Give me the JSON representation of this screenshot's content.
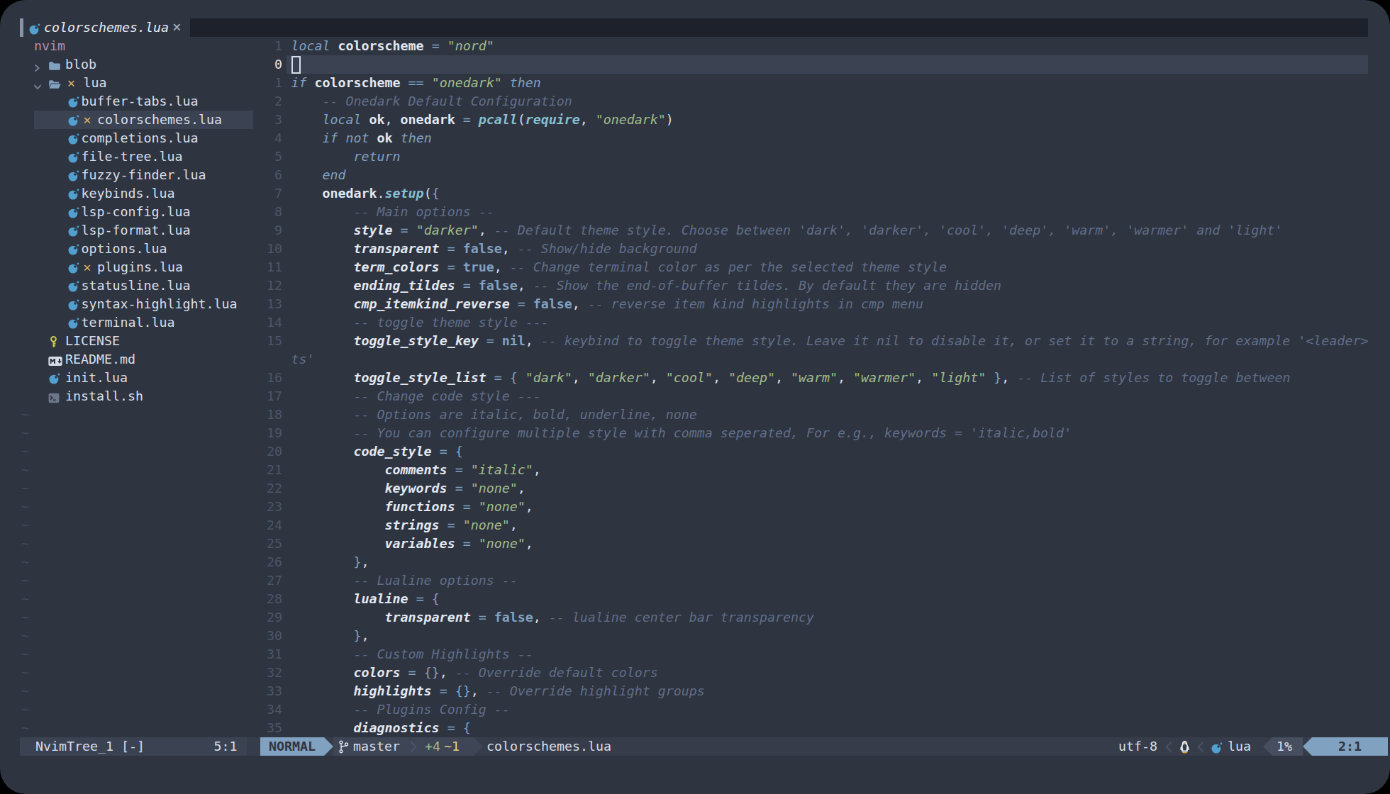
{
  "colors": {
    "background": "#2E3440",
    "surface": "#3B4252",
    "surface_bright": "#434C5E",
    "muted": "#4C566A",
    "foreground": "#D8DEE9",
    "foreground_bright": "#ECEFF4",
    "blue": "#81A1C1",
    "cyan": "#88C0D0",
    "green": "#A3BE8C",
    "yellow": "#EBCB8B",
    "purple": "#B48EAD",
    "comment": "#616E88",
    "tabline_fill": "#1B1F27",
    "statusline_bg": "#343B49",
    "lua_icon_blue": "#51A0CF",
    "license_icon_yellow": "#CBCB41"
  },
  "tabline": {
    "tabs": [
      {
        "label": "colorschemes.lua",
        "close": "×",
        "icon": "lua",
        "active": true
      }
    ]
  },
  "file_tree": {
    "root": "nvim",
    "items": [
      {
        "label": "blob",
        "kind": "folder",
        "arrow": "right",
        "level": 1
      },
      {
        "label": "lua",
        "kind": "folder-open",
        "arrow": "down",
        "level": 1,
        "git": "✕"
      },
      {
        "label": "buffer-tabs.lua",
        "kind": "lua",
        "level": 2
      },
      {
        "label": "colorschemes.lua",
        "kind": "lua",
        "level": 2,
        "git": "✕",
        "selected": true
      },
      {
        "label": "completions.lua",
        "kind": "lua",
        "level": 2
      },
      {
        "label": "file-tree.lua",
        "kind": "lua",
        "level": 2
      },
      {
        "label": "fuzzy-finder.lua",
        "kind": "lua",
        "level": 2
      },
      {
        "label": "keybinds.lua",
        "kind": "lua",
        "level": 2
      },
      {
        "label": "lsp-config.lua",
        "kind": "lua",
        "level": 2
      },
      {
        "label": "lsp-format.lua",
        "kind": "lua",
        "level": 2
      },
      {
        "label": "options.lua",
        "kind": "lua",
        "level": 2
      },
      {
        "label": "plugins.lua",
        "kind": "lua",
        "level": 2,
        "git": "✕"
      },
      {
        "label": "statusline.lua",
        "kind": "lua",
        "level": 2
      },
      {
        "label": "syntax-highlight.lua",
        "kind": "lua",
        "level": 2
      },
      {
        "label": "terminal.lua",
        "kind": "lua",
        "level": 2
      },
      {
        "label": "LICENSE",
        "kind": "key",
        "level": 1
      },
      {
        "label": "README.md",
        "kind": "markdown",
        "level": 1
      },
      {
        "label": "init.lua",
        "kind": "lua",
        "level": 1
      },
      {
        "label": "install.sh",
        "kind": "shell",
        "level": 1
      }
    ],
    "empty_line_marker": "~",
    "empty_line_count": 18
  },
  "editor": {
    "lines": [
      {
        "n": "1",
        "t": [
          [
            "kw",
            "local "
          ],
          [
            "id",
            "colorscheme "
          ],
          [
            "op",
            "= "
          ],
          [
            "st",
            "\"nord\""
          ]
        ]
      },
      {
        "n": "0",
        "cursor": true,
        "t": []
      },
      {
        "n": "1",
        "t": [
          [
            "kw",
            "if "
          ],
          [
            "id",
            "colorscheme "
          ],
          [
            "op",
            "== "
          ],
          [
            "st",
            "\"onedark\" "
          ],
          [
            "kw",
            "then"
          ]
        ]
      },
      {
        "n": "2",
        "t": [
          [
            "pn",
            "    "
          ],
          [
            "cm",
            "-- Onedark Default Configuration"
          ]
        ]
      },
      {
        "n": "3",
        "t": [
          [
            "pn",
            "    "
          ],
          [
            "kw",
            "local "
          ],
          [
            "id",
            "ok"
          ],
          [
            "pn",
            ", "
          ],
          [
            "id",
            "onedark "
          ],
          [
            "op",
            "= "
          ],
          [
            "fn",
            "pcall"
          ],
          [
            "pn",
            "("
          ],
          [
            "fn",
            "require"
          ],
          [
            "pn",
            ", "
          ],
          [
            "st",
            "\"onedark\""
          ],
          [
            "pn",
            ")"
          ]
        ]
      },
      {
        "n": "4",
        "t": [
          [
            "pn",
            "    "
          ],
          [
            "kw",
            "if "
          ],
          [
            "kw",
            "not "
          ],
          [
            "id",
            "ok "
          ],
          [
            "kw",
            "then"
          ]
        ]
      },
      {
        "n": "5",
        "t": [
          [
            "pn",
            "        "
          ],
          [
            "kw",
            "return"
          ]
        ]
      },
      {
        "n": "6",
        "t": [
          [
            "pn",
            "    "
          ],
          [
            "kw",
            "end"
          ]
        ]
      },
      {
        "n": "7",
        "t": [
          [
            "pn",
            "    "
          ],
          [
            "id",
            "onedark"
          ],
          [
            "pn",
            "."
          ],
          [
            "fn",
            "setup"
          ],
          [
            "pn",
            "("
          ],
          [
            "bl",
            "{"
          ]
        ]
      },
      {
        "n": "8",
        "t": [
          [
            "pn",
            "        "
          ],
          [
            "cm",
            "-- Main options --"
          ]
        ]
      },
      {
        "n": "9",
        "t": [
          [
            "pn",
            "        "
          ],
          [
            "fd",
            "style "
          ],
          [
            "op",
            "= "
          ],
          [
            "st",
            "\"darker\""
          ],
          [
            "pn",
            ", "
          ],
          [
            "cm",
            "-- Default theme style. Choose between 'dark', 'darker', 'cool', 'deep', 'warm', 'warmer' and 'light'"
          ]
        ]
      },
      {
        "n": "10",
        "t": [
          [
            "pn",
            "        "
          ],
          [
            "fd",
            "transparent "
          ],
          [
            "op",
            "= "
          ],
          [
            "bo",
            "false"
          ],
          [
            "pn",
            ", "
          ],
          [
            "cm",
            "-- Show/hide background"
          ]
        ]
      },
      {
        "n": "11",
        "t": [
          [
            "pn",
            "        "
          ],
          [
            "fd",
            "term_colors "
          ],
          [
            "op",
            "= "
          ],
          [
            "bo",
            "true"
          ],
          [
            "pn",
            ", "
          ],
          [
            "cm",
            "-- Change terminal color as per the selected theme style"
          ]
        ]
      },
      {
        "n": "12",
        "t": [
          [
            "pn",
            "        "
          ],
          [
            "fd",
            "ending_tildes "
          ],
          [
            "op",
            "= "
          ],
          [
            "bo",
            "false"
          ],
          [
            "pn",
            ", "
          ],
          [
            "cm",
            "-- Show the end-of-buffer tildes. By default they are hidden"
          ]
        ]
      },
      {
        "n": "13",
        "t": [
          [
            "pn",
            "        "
          ],
          [
            "fd",
            "cmp_itemkind_reverse "
          ],
          [
            "op",
            "= "
          ],
          [
            "bo",
            "false"
          ],
          [
            "pn",
            ", "
          ],
          [
            "cm",
            "-- reverse item kind highlights in cmp menu"
          ]
        ]
      },
      {
        "n": "14",
        "t": [
          [
            "pn",
            "        "
          ],
          [
            "cm",
            "-- toggle theme style ---"
          ]
        ]
      },
      {
        "n": "15",
        "t": [
          [
            "pn",
            "        "
          ],
          [
            "fd",
            "toggle_style_key "
          ],
          [
            "op",
            "= "
          ],
          [
            "bo",
            "nil"
          ],
          [
            "pn",
            ", "
          ],
          [
            "cm",
            "-- keybind to toggle theme style. Leave it nil to disable it, or set it to a string, for example '<leader>"
          ]
        ]
      },
      {
        "n": "",
        "t": [
          [
            "cm",
            "ts'"
          ]
        ]
      },
      {
        "n": "16",
        "t": [
          [
            "pn",
            "        "
          ],
          [
            "fd",
            "toggle_style_list "
          ],
          [
            "op",
            "= "
          ],
          [
            "bl",
            "{ "
          ],
          [
            "st",
            "\"dark\""
          ],
          [
            "pn",
            ", "
          ],
          [
            "st",
            "\"darker\""
          ],
          [
            "pn",
            ", "
          ],
          [
            "st",
            "\"cool\""
          ],
          [
            "pn",
            ", "
          ],
          [
            "st",
            "\"deep\""
          ],
          [
            "pn",
            ", "
          ],
          [
            "st",
            "\"warm\""
          ],
          [
            "pn",
            ", "
          ],
          [
            "st",
            "\"warmer\""
          ],
          [
            "pn",
            ", "
          ],
          [
            "st",
            "\"light\" "
          ],
          [
            "bl",
            "}"
          ],
          [
            "pn",
            ", "
          ],
          [
            "cm",
            "-- List of styles to toggle between"
          ]
        ]
      },
      {
        "n": "17",
        "t": [
          [
            "pn",
            "        "
          ],
          [
            "cm",
            "-- Change code style ---"
          ]
        ]
      },
      {
        "n": "18",
        "t": [
          [
            "pn",
            "        "
          ],
          [
            "cm",
            "-- Options are italic, bold, underline, none"
          ]
        ]
      },
      {
        "n": "19",
        "t": [
          [
            "pn",
            "        "
          ],
          [
            "cm",
            "-- You can configure multiple style with comma seperated, For e.g., keywords = 'italic,bold'"
          ]
        ]
      },
      {
        "n": "20",
        "t": [
          [
            "pn",
            "        "
          ],
          [
            "fd",
            "code_style "
          ],
          [
            "op",
            "= "
          ],
          [
            "bl",
            "{"
          ]
        ]
      },
      {
        "n": "21",
        "t": [
          [
            "pn",
            "            "
          ],
          [
            "fd",
            "comments "
          ],
          [
            "op",
            "= "
          ],
          [
            "st",
            "\"italic\""
          ],
          [
            "pn",
            ","
          ]
        ]
      },
      {
        "n": "22",
        "t": [
          [
            "pn",
            "            "
          ],
          [
            "fd",
            "keywords "
          ],
          [
            "op",
            "= "
          ],
          [
            "st",
            "\"none\""
          ],
          [
            "pn",
            ","
          ]
        ]
      },
      {
        "n": "23",
        "t": [
          [
            "pn",
            "            "
          ],
          [
            "fd",
            "functions "
          ],
          [
            "op",
            "= "
          ],
          [
            "st",
            "\"none\""
          ],
          [
            "pn",
            ","
          ]
        ]
      },
      {
        "n": "24",
        "t": [
          [
            "pn",
            "            "
          ],
          [
            "fd",
            "strings "
          ],
          [
            "op",
            "= "
          ],
          [
            "st",
            "\"none\""
          ],
          [
            "pn",
            ","
          ]
        ]
      },
      {
        "n": "25",
        "t": [
          [
            "pn",
            "            "
          ],
          [
            "fd",
            "variables "
          ],
          [
            "op",
            "= "
          ],
          [
            "st",
            "\"none\""
          ],
          [
            "pn",
            ","
          ]
        ]
      },
      {
        "n": "26",
        "t": [
          [
            "pn",
            "        "
          ],
          [
            "bl",
            "}"
          ],
          [
            "pn",
            ","
          ]
        ]
      },
      {
        "n": "27",
        "t": [
          [
            "pn",
            "        "
          ],
          [
            "cm",
            "-- Lualine options --"
          ]
        ]
      },
      {
        "n": "28",
        "t": [
          [
            "pn",
            "        "
          ],
          [
            "fd",
            "lualine "
          ],
          [
            "op",
            "= "
          ],
          [
            "bl",
            "{"
          ]
        ]
      },
      {
        "n": "29",
        "t": [
          [
            "pn",
            "            "
          ],
          [
            "fd",
            "transparent "
          ],
          [
            "op",
            "= "
          ],
          [
            "bo",
            "false"
          ],
          [
            "pn",
            ", "
          ],
          [
            "cm",
            "-- lualine center bar transparency"
          ]
        ]
      },
      {
        "n": "30",
        "t": [
          [
            "pn",
            "        "
          ],
          [
            "bl",
            "}"
          ],
          [
            "pn",
            ","
          ]
        ]
      },
      {
        "n": "31",
        "t": [
          [
            "pn",
            "        "
          ],
          [
            "cm",
            "-- Custom Highlights --"
          ]
        ]
      },
      {
        "n": "32",
        "t": [
          [
            "pn",
            "        "
          ],
          [
            "fd",
            "colors "
          ],
          [
            "op",
            "= "
          ],
          [
            "bl",
            "{}"
          ],
          [
            "pn",
            ", "
          ],
          [
            "cm",
            "-- Override default colors"
          ]
        ]
      },
      {
        "n": "33",
        "t": [
          [
            "pn",
            "        "
          ],
          [
            "fd",
            "highlights "
          ],
          [
            "op",
            "= "
          ],
          [
            "bl",
            "{}"
          ],
          [
            "pn",
            ", "
          ],
          [
            "cm",
            "-- Override highlight groups"
          ]
        ]
      },
      {
        "n": "34",
        "t": [
          [
            "pn",
            "        "
          ],
          [
            "cm",
            "-- Plugins Config --"
          ]
        ]
      },
      {
        "n": "35",
        "t": [
          [
            "pn",
            "        "
          ],
          [
            "fd",
            "diagnostics "
          ],
          [
            "op",
            "= "
          ],
          [
            "bl",
            "{"
          ]
        ]
      }
    ]
  },
  "statusline": {
    "tree_title": "NvimTree_1 [-]",
    "tree_position": "5:1",
    "mode": "NORMAL",
    "branch": "master",
    "diff_added": "+4",
    "diff_modified": "~1",
    "filename": "colorschemes.lua",
    "encoding": "utf-8",
    "filetype": "lua",
    "progress": "1%",
    "location": "2:1"
  }
}
